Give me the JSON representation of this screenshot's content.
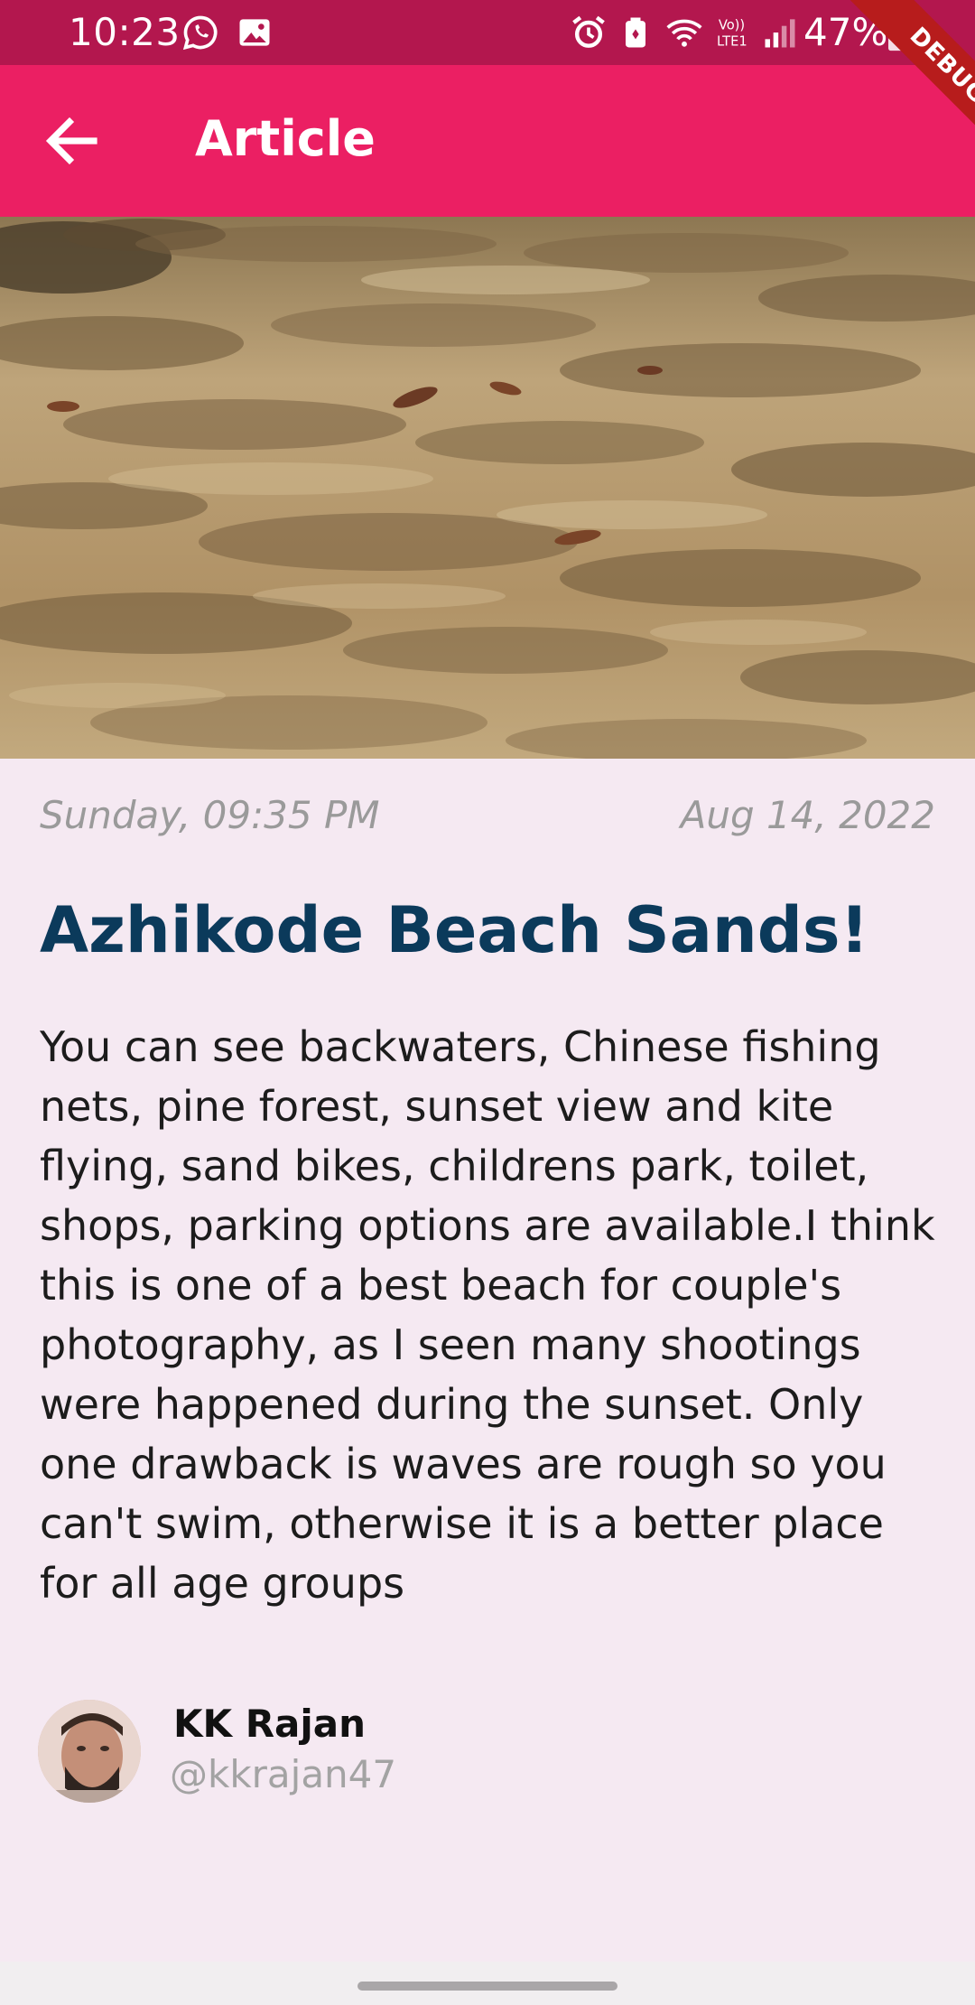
{
  "status_bar": {
    "time": "10:23",
    "battery": "47%",
    "icons": [
      "whatsapp-icon",
      "gallery-icon",
      "alarm-icon",
      "security-icon",
      "wifi-icon",
      "volte-icon",
      "signal-icon",
      "battery-icon"
    ],
    "color": "#b3174e"
  },
  "debug_banner": "DEBUG",
  "app_bar": {
    "title": "Article",
    "color": "#eb1f63"
  },
  "article": {
    "day": "Sunday, 09:35 PM",
    "date": "Aug 14, 2022",
    "title": "Azhikode Beach Sands!",
    "body": "You can see backwaters, Chinese fishing nets, pine forest, sunset view and kite flying, sand bikes, childrens park, toilet, shops, parking options are available.I think this is one of a best beach for couple's photography, as I seen many shootings were happened during the sunset. Only one drawback is waves are rough so you can't swim, otherwise it is a better place for all age groups"
  },
  "author": {
    "name": "KK Rajan",
    "handle": "@kkrajan47"
  },
  "colors": {
    "background": "#f5e9f2",
    "title": "#0b3a5b",
    "muted": "#9a9a9a"
  }
}
